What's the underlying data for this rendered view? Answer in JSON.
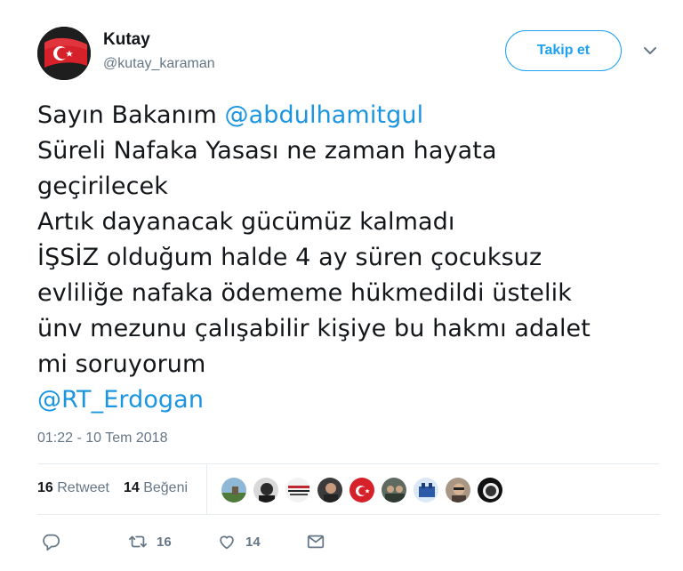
{
  "user": {
    "name": "Kutay",
    "handle": "@kutay_karaman",
    "avatar_icon": "turkish-flag-avatar"
  },
  "follow_button": {
    "label": "Takip et"
  },
  "menu": {
    "icon": "chevron-down-icon"
  },
  "tweet": {
    "lines": [
      {
        "text": "Sayın Bakanım ",
        "mention": "@abdulhamitgul"
      },
      {
        "text": "Süreli Nafaka Yasası ne zaman hayata"
      },
      {
        "text": "geçirilecek"
      },
      {
        "text": "Artık dayanacak gücümüz kalmadı"
      },
      {
        "text": "İŞSİZ olduğum halde 4 ay süren çocuksuz"
      },
      {
        "text": "evliliğe nafaka ödememe hükmedildi üstelik"
      },
      {
        "text": "ünv mezunu çalışabilir kişiye bu hakmı adalet"
      },
      {
        "text": "mi soruyorum"
      },
      {
        "text": "",
        "mention": "@RT_Erdogan"
      }
    ],
    "timestamp": "01:22 - 10 Tem 2018"
  },
  "stats": {
    "retweets_count": "16",
    "retweets_label": "Retweet",
    "likes_count": "14",
    "likes_label": "Beğeni"
  },
  "actions": {
    "reply_icon": "reply-icon",
    "retweet_icon": "retweet-icon",
    "retweet_count": "16",
    "like_icon": "heart-icon",
    "like_count": "14",
    "message_icon": "envelope-icon"
  },
  "colors": {
    "accent": "#1da1f2",
    "mention": "#1b95e0",
    "secondary_text": "#657786",
    "divider": "#e6ecf0"
  }
}
